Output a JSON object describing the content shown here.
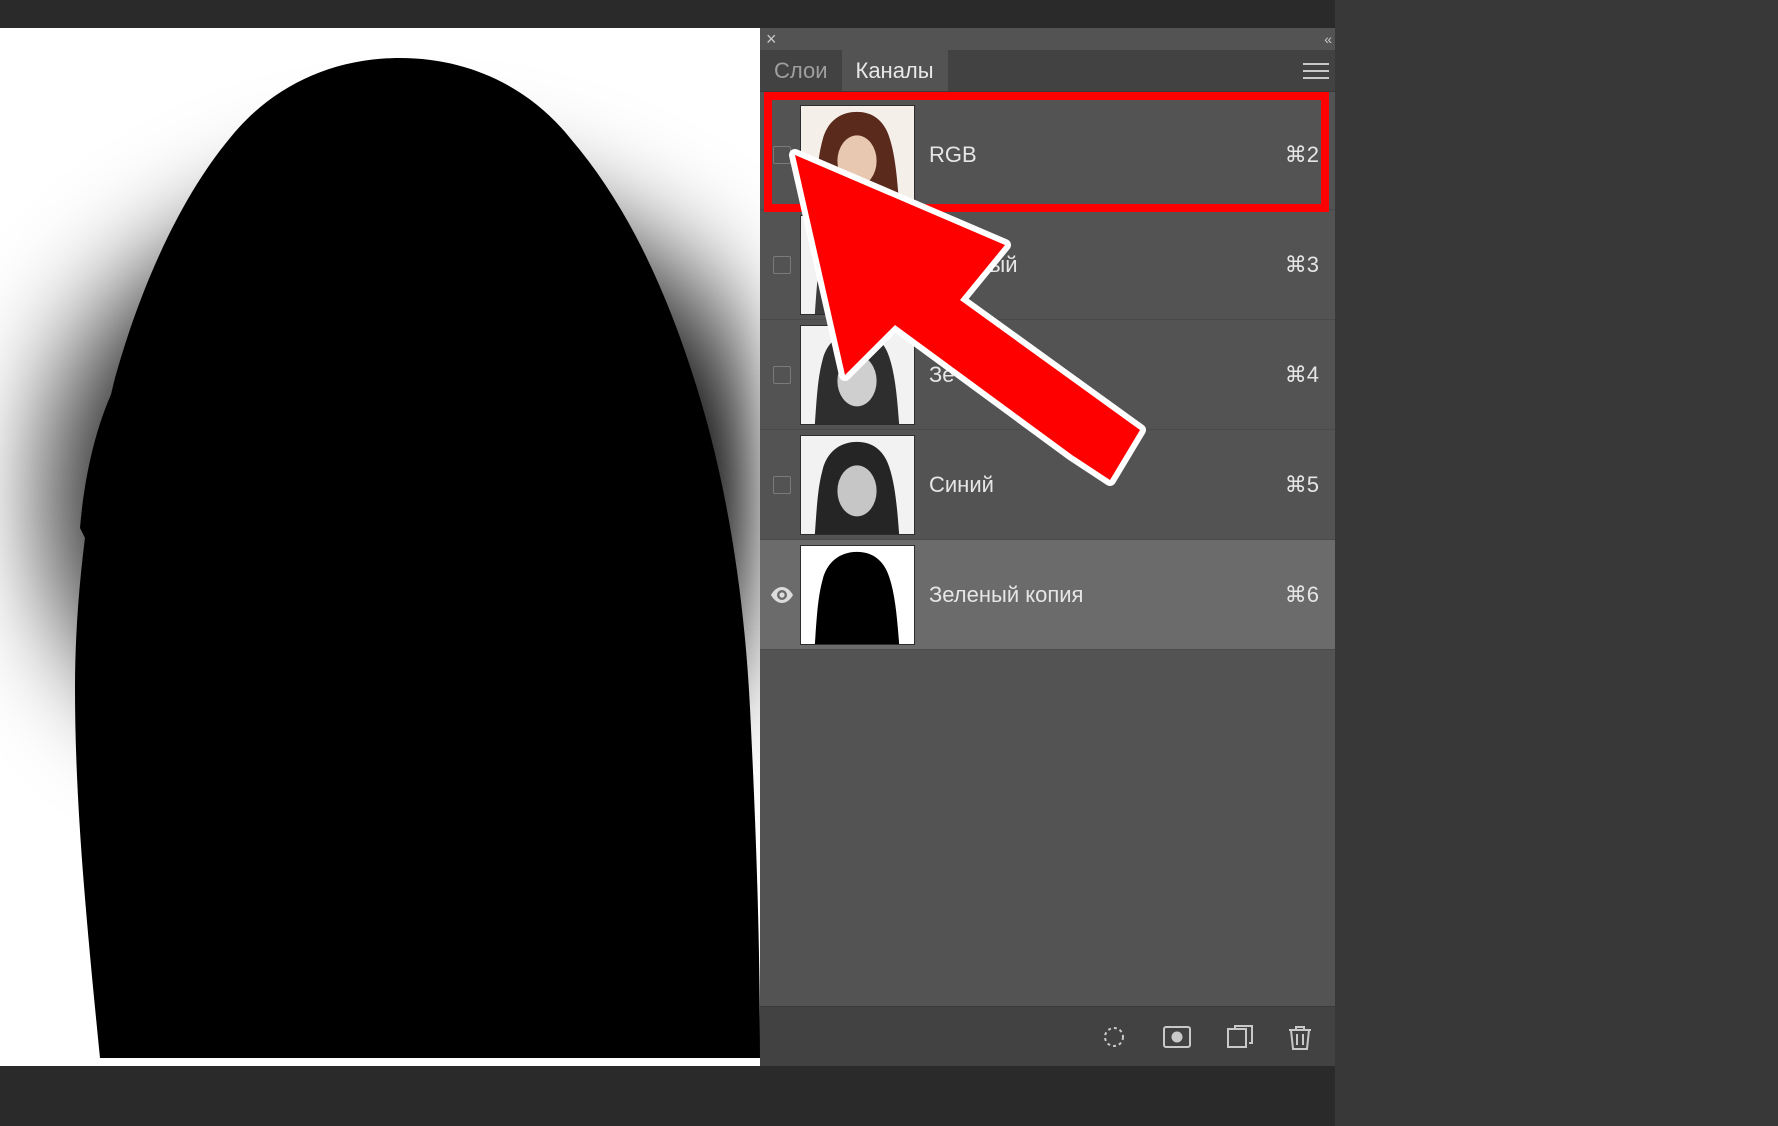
{
  "panel": {
    "tabs": [
      {
        "label": "Слои",
        "active": false
      },
      {
        "label": "Каналы",
        "active": true
      }
    ],
    "channels": [
      {
        "name": "RGB",
        "shortcut": "⌘2",
        "visible": false,
        "selected": false,
        "thumb": "color",
        "highlighted": true
      },
      {
        "name": "Красный",
        "shortcut": "⌘3",
        "visible": false,
        "selected": false,
        "thumb": "gray"
      },
      {
        "name": "Зеленый",
        "shortcut": "⌘4",
        "visible": false,
        "selected": false,
        "thumb": "gray",
        "labelShown": "Зе"
      },
      {
        "name": "Синий",
        "shortcut": "⌘5",
        "visible": false,
        "selected": false,
        "thumb": "gray"
      },
      {
        "name": "Зеленый копия",
        "shortcut": "⌘6",
        "visible": true,
        "selected": true,
        "thumb": "mask"
      }
    ],
    "footerIcons": [
      "load-selection-icon",
      "save-mask-icon",
      "new-channel-icon",
      "trash-icon"
    ]
  },
  "topbarIcons": {
    "close": "close-icon",
    "collapse": "collapse-icon",
    "menu": "panel-menu-icon"
  },
  "annotation": {
    "arrowColor": "#ff0000"
  }
}
